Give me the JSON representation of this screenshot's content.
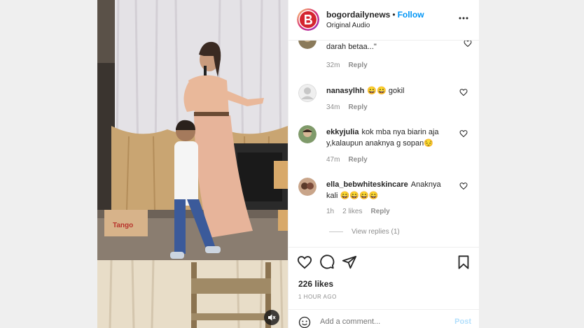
{
  "header": {
    "username": "bogordailynews",
    "separator": "•",
    "follow_label": "Follow",
    "audio": "Original Audio"
  },
  "comments": {
    "partial": {
      "text": "darah betaa...\"",
      "time": "32m",
      "reply": "Reply"
    },
    "items": [
      {
        "user": "nanasylhh",
        "text": "😄😄 gokil",
        "time": "34m",
        "likes": "",
        "reply": "Reply"
      },
      {
        "user": "ekkyjulia",
        "text": "kok mba nya biarin aja y,kalaupun anaknya g sopan😔",
        "time": "47m",
        "likes": "",
        "reply": "Reply"
      },
      {
        "user": "ella_bebwhiteskincare",
        "text": "Anaknya kali 😄😄😄😄",
        "time": "1h",
        "likes": "2 likes",
        "reply": "Reply"
      }
    ],
    "view_replies": "View replies (1)"
  },
  "actions": {
    "likes": "226 likes",
    "time_ago": "1 HOUR AGO",
    "add_comment_placeholder": "Add a comment...",
    "post_label": "Post"
  },
  "colors": {
    "accent": "#0095f6",
    "post_disabled": "#b2dffc",
    "text": "#262626",
    "muted": "#8e8e8e"
  },
  "icons": [
    "more-options-icon",
    "heart-icon",
    "comment-icon",
    "share-icon",
    "bookmark-icon",
    "emoji-icon",
    "sound-off-icon"
  ]
}
